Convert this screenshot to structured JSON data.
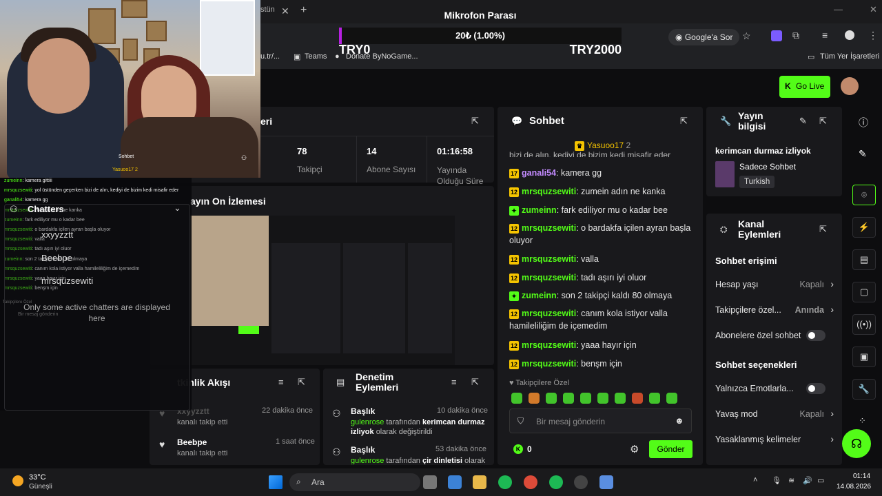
{
  "browser": {
    "tab_fragment": "stün",
    "address_button": "Google'a Sor",
    "bookmarks": [
      "u.tr/...",
      "Teams",
      "Donate ByNoGame...",
      "Tüm Yer İşaretleri"
    ]
  },
  "goal_overlay": {
    "title": "Mikrofon Parası",
    "amount": "20₺ (1.00%)",
    "progress_fraction": 0.01,
    "min_label": "TRY0",
    "max_label": "TRY2000",
    "accent": "#b620e0"
  },
  "header": {
    "golive_label": "Go Live"
  },
  "stats": {
    "title_fragment": "eri",
    "items": [
      {
        "value": "78",
        "label": "Takipçi"
      },
      {
        "value": "14",
        "label": "Abone Sayısı"
      },
      {
        "value": "01:16:58",
        "label": "Yayında Olduğu Süre"
      }
    ]
  },
  "preview": {
    "title": "ayın On İzlemesi"
  },
  "activity": {
    "title": "tkinlik Akışı",
    "items": [
      {
        "user": "xxyyzztt",
        "time": "22 dakika önce",
        "action": "kanalı takip etti"
      },
      {
        "user": "Beebpe",
        "time": "1 saat önce",
        "action": "kanalı takip etti"
      }
    ]
  },
  "moderation": {
    "title": "Denetim Eylemleri",
    "items": [
      {
        "heading": "Başlık",
        "time": "10 dakika önce",
        "user": "gulenrose",
        "mid": "tarafından",
        "value": "kerimcan durmaz izliyok",
        "tail": "olarak değiştirildi"
      },
      {
        "heading": "Başlık",
        "time": "53 dakika önce",
        "user": "gulenrose",
        "mid": "tarafından",
        "value": "çir dinletisi",
        "tail": "olarak"
      }
    ]
  },
  "chat": {
    "title": "Sohbet",
    "pinned_user": "Yasuoo17",
    "pinned_count": "2",
    "clipped_top": "bizi de alın, kediyi de bizim kedi misafir eder",
    "messages": [
      {
        "badge": "17",
        "user": "ganali54",
        "text": ": kamera gg"
      },
      {
        "badge": "12",
        "user": "mrsquzsewiti",
        "text": ": zumein adın ne kanka"
      },
      {
        "badge": "",
        "user": "zumeinn",
        "text": ": fark ediliyor mu o kadar bee"
      },
      {
        "badge": "12",
        "user": "mrsquzsewiti",
        "text": ": o bardakfa içilen ayran başla oluyor"
      },
      {
        "badge": "12",
        "user": "mrsquzsewiti",
        "text": ": valla"
      },
      {
        "badge": "12",
        "user": "mrsquzsewiti",
        "text": ": tadı aşırı iyi oluor"
      },
      {
        "badge": "",
        "user": "zumeinn",
        "text": ": son 2 takipçi kaldı 80 olmaya"
      },
      {
        "badge": "12",
        "user": "mrsquzsewiti",
        "text": ": canım kola istiyor valla hamileliliğim de içemedim"
      },
      {
        "badge": "12",
        "user": "mrsquzsewiti",
        "text": ": yaaa hayır için"
      },
      {
        "badge": "12",
        "user": "mrsquzsewiti",
        "text": ": benşm için"
      }
    ],
    "followers_only": "Takipçilere Özel",
    "input_placeholder": "Bir mesaj gönderin",
    "kick_count": "0",
    "send_label": "Gönder"
  },
  "stream_info": {
    "title": "Yayın bilgisi",
    "stream_title": "kerimcan durmaz izliyok",
    "category": "Sadece Sohbet",
    "language": "Turkish"
  },
  "channel_actions": {
    "title": "Kanal Eylemleri",
    "section1": "Sohbet erişimi",
    "rows1": [
      {
        "label": "Hesap yaşı",
        "value": "Kapalı"
      },
      {
        "label": "Takipçilere özel...",
        "value": "Anında"
      },
      {
        "label": "Abonelere özel sohbet",
        "value": ""
      }
    ],
    "section2": "Sohbet seçenekleri",
    "rows2": [
      {
        "label": "Yalnızca Emotlarla...",
        "value": ""
      },
      {
        "label": "Yavaş mod",
        "value": "Kapalı"
      },
      {
        "label": "Yasaklanmış kelimeler",
        "value": ""
      }
    ]
  },
  "stream_overlay": {
    "label": "Sohbet",
    "pinned": "Yasuoo17 2",
    "lines": [
      {
        "u": "zumeinn",
        "t": ": kamera gittiii"
      },
      {
        "u": "mrsquzsewiti",
        "t": ": yol üstünden geçerken bizi de alın, kediyi de bizim kedi misafir eder"
      },
      {
        "u": "ganali54",
        "t": ": kamera gg"
      },
      {
        "u": "mrsquzsewiti",
        "t": ": zumein adın ne kanka"
      },
      {
        "u": "zumeinn",
        "t": ": fark ediliyor mu o kadar bee"
      },
      {
        "u": "mrsquzsewiti",
        "t": ": o bardakfa içilen ayran başla oluyor"
      },
      {
        "u": "mrsquzsewiti",
        "t": ": valla"
      },
      {
        "u": "mrsquzsewiti",
        "t": ": tadı aşırı iyi oluor"
      },
      {
        "u": "zumeinn",
        "t": ": son 2 takipçi kaldı 80 olmaya"
      },
      {
        "u": "mrsquzsewiti",
        "t": ": canım kola istiyor valla hamileliliğim de içemedim"
      },
      {
        "u": "mrsquzsewiti",
        "t": ": yaaa hayır için"
      },
      {
        "u": "mrsquzsewiti",
        "t": ": benşm için"
      }
    ],
    "followers": "Takipçilere Özel",
    "input": "Bir mesaj gönderin"
  },
  "chatters": {
    "title": "Chatters",
    "names": [
      "xxyyzztt",
      "Beebpe",
      "mrsquzsewiti"
    ],
    "note": "Only some active chatters are displayed here"
  },
  "taskbar": {
    "temp": "33°C",
    "weather": "Güneşli",
    "search": "Ara",
    "time": "01:14",
    "date": "14.08.2026"
  }
}
